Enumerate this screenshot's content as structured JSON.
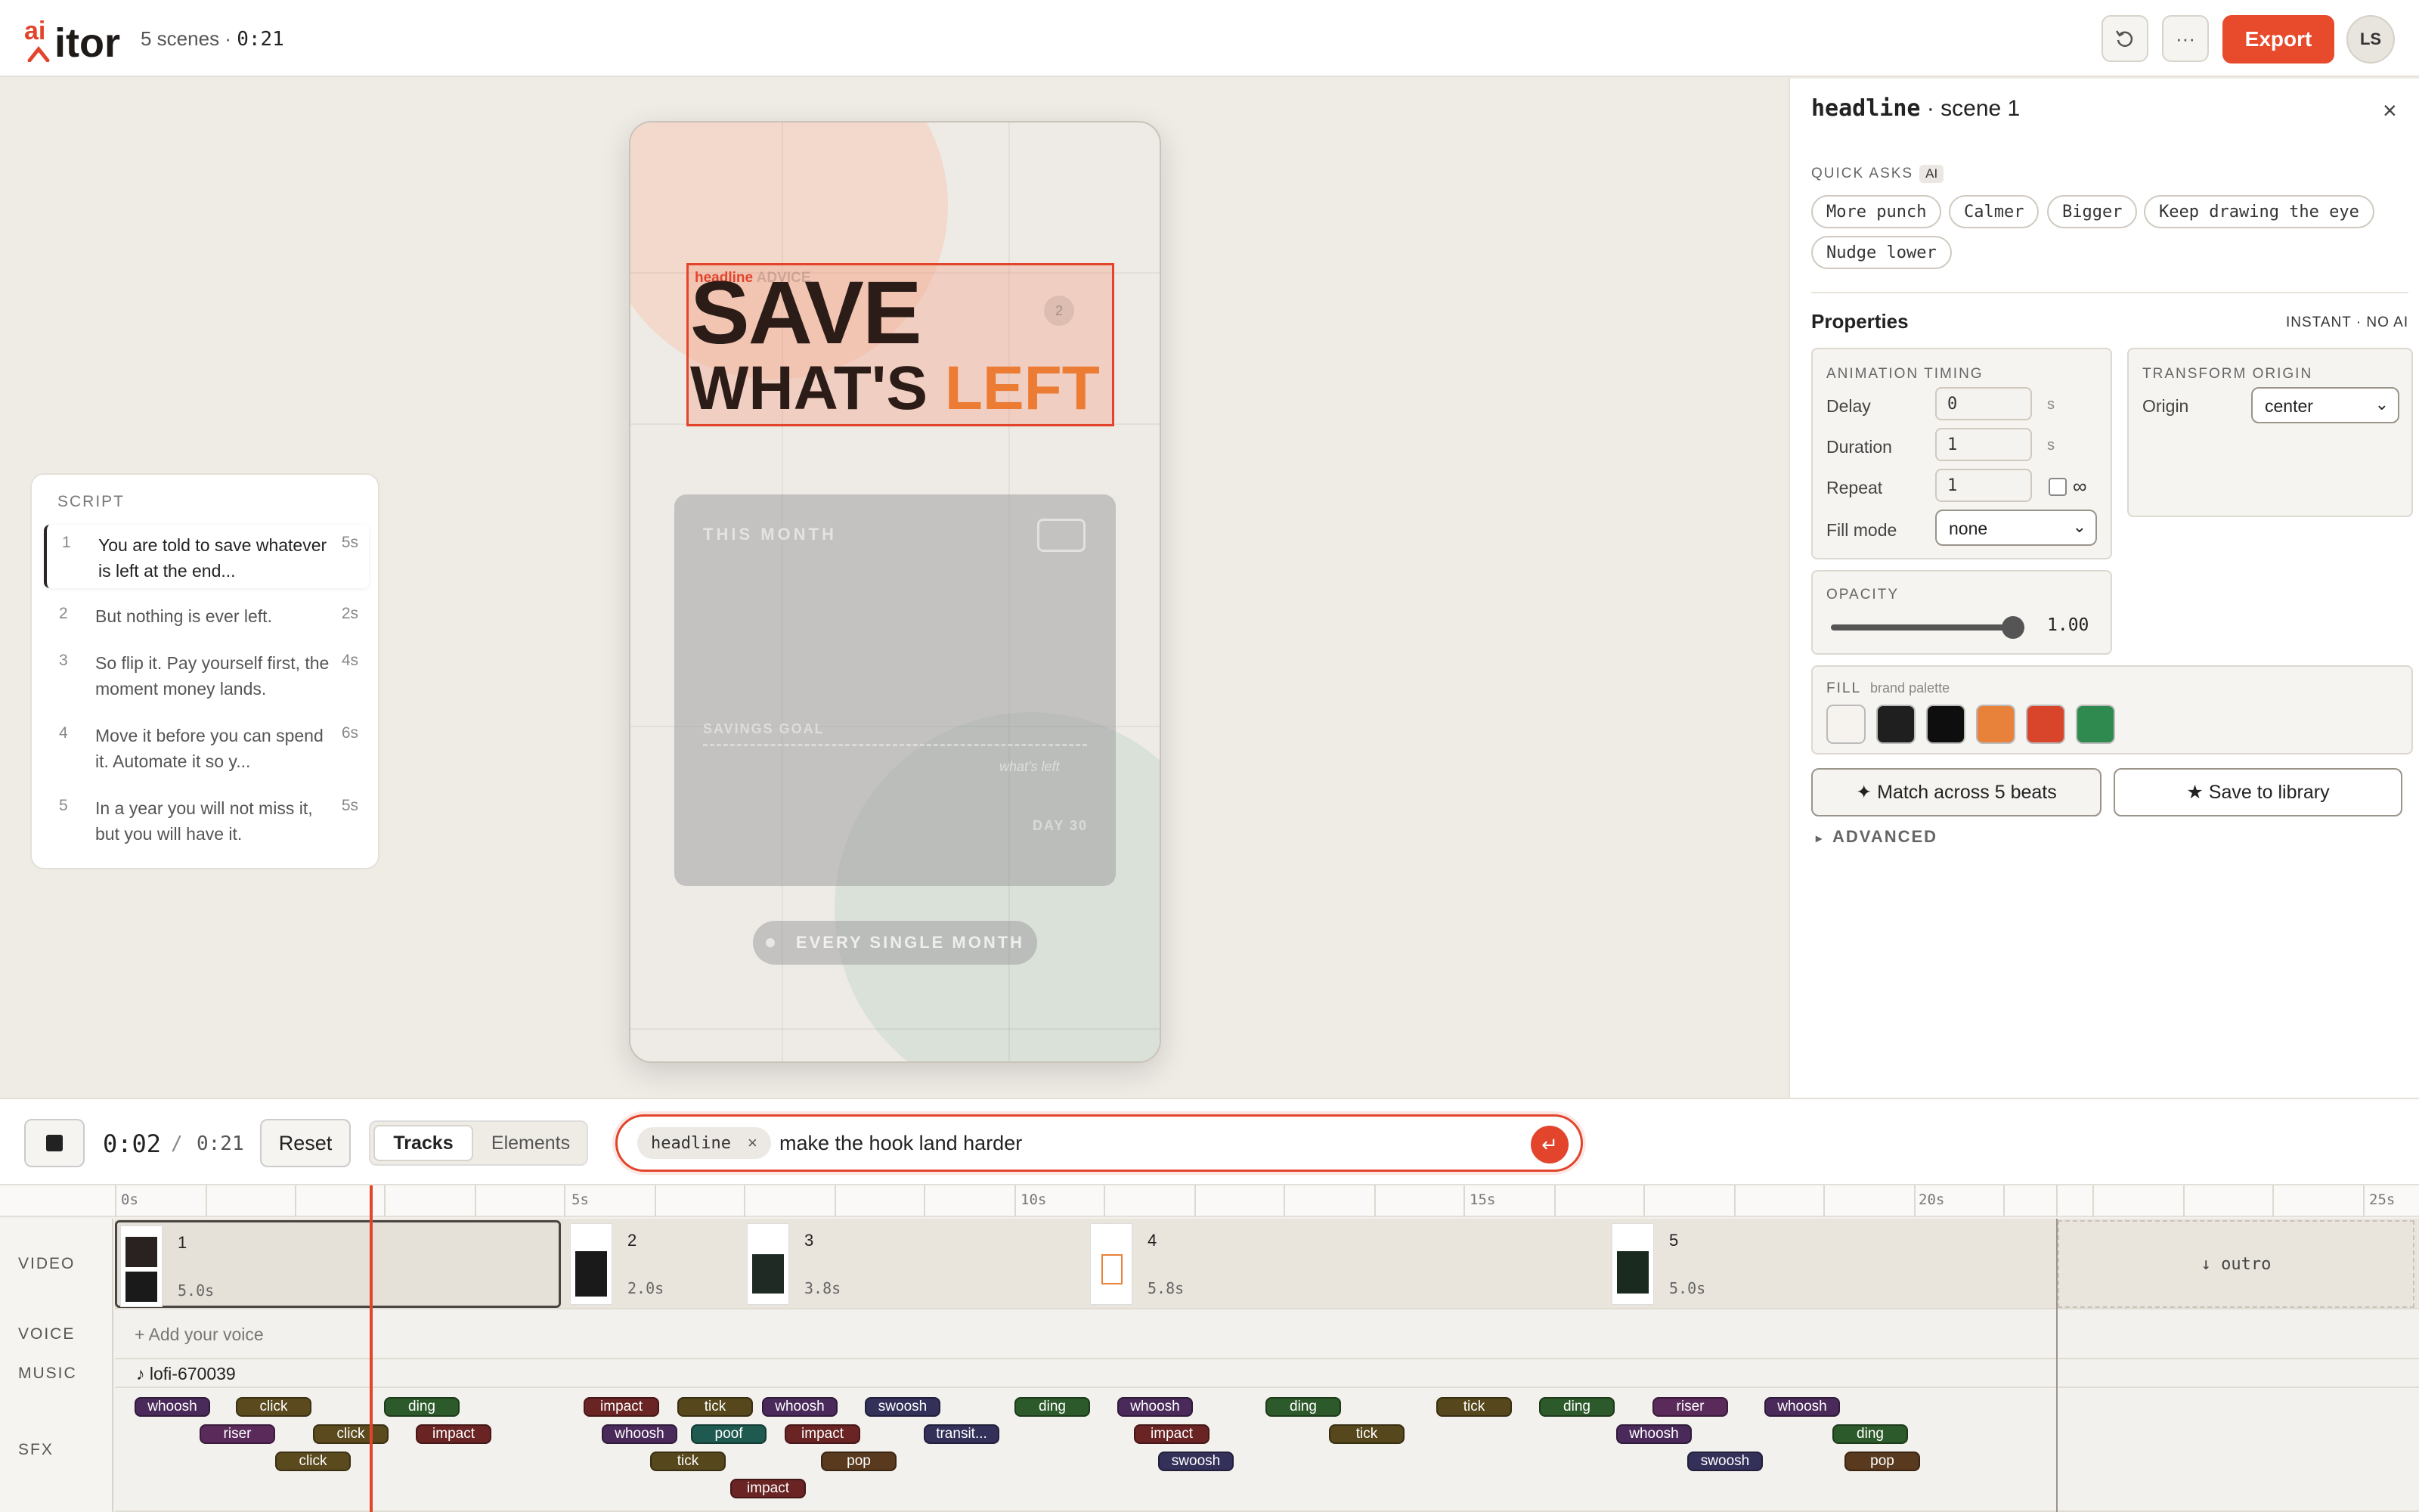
{
  "header": {
    "logo_ai": "ai",
    "logo_text": "itor",
    "scene_count": "5 scenes ·",
    "duration": "0:21",
    "export_label": "Export",
    "avatar_initials": "LS",
    "history_icon": "history-icon",
    "more_icon": "more-icon"
  },
  "canvas": {
    "headline_tag": "headline",
    "headline_tag_ghost": "ADVICE",
    "headline_line1": "SAVE",
    "headline_line2_a": "WHAT'S",
    "headline_line2_b": "LEFT",
    "badge": "2",
    "card_label": "THIS MONTH",
    "card_goal": "SAVINGS GOAL",
    "card_whats_left": "what's left",
    "card_day": "DAY 30",
    "pill": "EVERY SINGLE MONTH"
  },
  "script": {
    "title": "SCRIPT",
    "items": [
      {
        "n": "1",
        "text": "You are told to save whatever is left at the end...",
        "dur": "5s"
      },
      {
        "n": "2",
        "text": "But nothing is ever left.",
        "dur": "2s"
      },
      {
        "n": "3",
        "text": "So flip it. Pay yourself first, the moment money lands.",
        "dur": "4s"
      },
      {
        "n": "4",
        "text": "Move it before you can spend it. Automate it so y...",
        "dur": "6s"
      },
      {
        "n": "5",
        "text": "In a year you will not miss it, but you will have it.",
        "dur": "5s"
      }
    ]
  },
  "panel": {
    "element": "headline",
    "scene": "· scene 1",
    "close": "×",
    "quick_asks_label": "QUICK ASKS",
    "ai_badge": "AI",
    "quick_asks": [
      "More punch",
      "Calmer",
      "Bigger",
      "Keep drawing the eye",
      "Nudge lower"
    ],
    "properties_title": "Properties",
    "properties_note": "INSTANT · NO AI",
    "animation_timing": "ANIMATION TIMING",
    "delay_label": "Delay",
    "delay_value": "0",
    "delay_unit": "s",
    "duration_label": "Duration",
    "duration_value": "1",
    "duration_unit": "s",
    "repeat_label": "Repeat",
    "repeat_value": "1",
    "infinite": "∞",
    "fill_mode_label": "Fill mode",
    "fill_mode_value": "none",
    "transform_origin": "TRANSFORM ORIGIN",
    "origin_label": "Origin",
    "origin_value": "center",
    "opacity_label": "OPACITY",
    "opacity_value": "1.00",
    "opacity": 1.0,
    "fill_label": "FILL",
    "fill_sub": "brand palette",
    "palette": [
      "#f6f3ee",
      "#1f1f1f",
      "#0e0e0e",
      "#e8823a",
      "#d9452a",
      "#2e8a4e"
    ],
    "match_label": "✦ Match across 5 beats",
    "save_label": "★ Save to library",
    "advanced_label": "ADVANCED",
    "advanced_caret": "▸"
  },
  "controls": {
    "time_current": "0:02",
    "time_sep": "/",
    "time_total": "0:21",
    "reset_label": "Reset",
    "tab_tracks": "Tracks",
    "tab_elements": "Elements",
    "prompt_chip": "headline",
    "prompt_chip_x": "×",
    "prompt_text": "make the hook land harder",
    "send_icon": "↵"
  },
  "timeline": {
    "ruler": [
      "0s",
      "5s",
      "10s",
      "15s",
      "20s",
      "25s"
    ],
    "tracks": [
      "VIDEO",
      "VOICE",
      "MUSIC",
      "SFX"
    ],
    "clips": [
      {
        "n": "1",
        "dur": "5.0s"
      },
      {
        "n": "2",
        "dur": "2.0s"
      },
      {
        "n": "3",
        "dur": "3.8s"
      },
      {
        "n": "4",
        "dur": "5.8s"
      },
      {
        "n": "5",
        "dur": "5.0s"
      }
    ],
    "outro": "↓ outro",
    "voice_add": "+ Add your voice",
    "music_note": "♪",
    "music_track": "lofi-670039",
    "sfx": [
      {
        "label": "whoosh",
        "kind": "whoosh"
      },
      {
        "label": "click",
        "kind": "click"
      },
      {
        "label": "ding",
        "kind": "ding"
      },
      {
        "label": "riser",
        "kind": "riser"
      },
      {
        "label": "click",
        "kind": "click"
      },
      {
        "label": "impact",
        "kind": "impact"
      },
      {
        "label": "click",
        "kind": "click"
      },
      {
        "label": "impact",
        "kind": "impact"
      },
      {
        "label": "tick",
        "kind": "tick"
      },
      {
        "label": "whoosh",
        "kind": "whoosh"
      },
      {
        "label": "swoosh",
        "kind": "swoosh"
      },
      {
        "label": "whoosh",
        "kind": "whoosh"
      },
      {
        "label": "poof",
        "kind": "poof"
      },
      {
        "label": "impact",
        "kind": "impact"
      },
      {
        "label": "transit...",
        "kind": "swoosh"
      },
      {
        "label": "tick",
        "kind": "tick"
      },
      {
        "label": "pop",
        "kind": "pop"
      },
      {
        "label": "impact",
        "kind": "impact"
      },
      {
        "label": "ding",
        "kind": "ding"
      },
      {
        "label": "whoosh",
        "kind": "whoosh"
      },
      {
        "label": "impact",
        "kind": "impact"
      },
      {
        "label": "swoosh",
        "kind": "swoosh"
      },
      {
        "label": "ding",
        "kind": "ding"
      },
      {
        "label": "tick",
        "kind": "tick"
      },
      {
        "label": "tick",
        "kind": "tick"
      },
      {
        "label": "ding",
        "kind": "ding"
      },
      {
        "label": "riser",
        "kind": "riser"
      },
      {
        "label": "whoosh",
        "kind": "whoosh"
      },
      {
        "label": "whoosh",
        "kind": "whoosh"
      },
      {
        "label": "swoosh",
        "kind": "swoosh"
      },
      {
        "label": "ding",
        "kind": "ding"
      },
      {
        "label": "pop",
        "kind": "pop"
      }
    ],
    "sfx_colors": {
      "whoosh": "#4a2a5a",
      "click": "#5a4a1e",
      "ding": "#2d5a2a",
      "riser": "#5a2a5a",
      "impact": "#6a2424",
      "tick": "#56481c",
      "swoosh": "#33305a",
      "poof": "#1e5a50",
      "pop": "#5a3a1e"
    }
  }
}
